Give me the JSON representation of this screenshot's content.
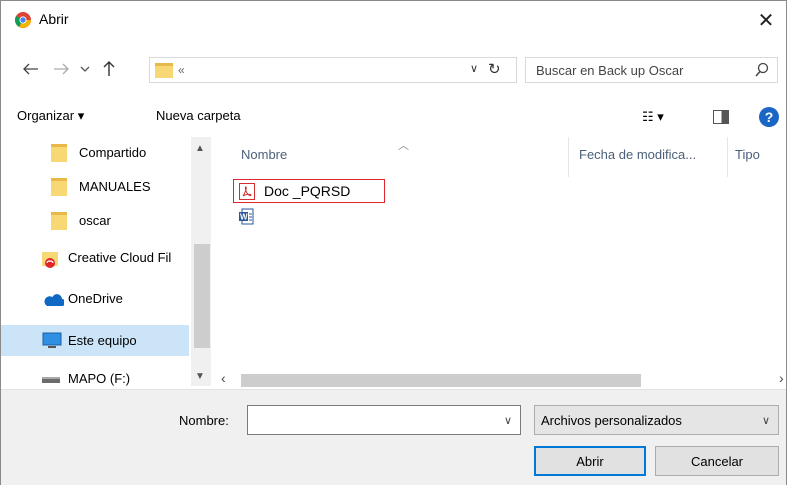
{
  "window": {
    "title": "Abrir",
    "close_glyph": "✕"
  },
  "address": {
    "crumb": "«",
    "refresh_glyph": "↻",
    "dropdown_glyph": "∨"
  },
  "search": {
    "placeholder": "Buscar en Back up Oscar"
  },
  "toolbar": {
    "organize_label": "Organizar ▾",
    "new_folder_label": "Nueva carpeta",
    "view_label": "☷ ▾",
    "help_label": "?"
  },
  "sidebar": {
    "items": [
      {
        "label": "Compartido",
        "icon": "folder-icon"
      },
      {
        "label": "MANUALES",
        "icon": "folder-icon"
      },
      {
        "label": "oscar",
        "icon": "folder-icon"
      },
      {
        "label": "Creative Cloud Fil",
        "icon": "creative-cloud-icon"
      },
      {
        "label": "OneDrive",
        "icon": "onedrive-icon"
      },
      {
        "label": "Este equipo",
        "icon": "computer-icon",
        "selected": true
      },
      {
        "label": "MAPO (F:)",
        "icon": "drive-icon"
      }
    ]
  },
  "filelist": {
    "columns": [
      "Nombre",
      "Fecha de modifica...",
      "Tipo"
    ],
    "files": [
      {
        "name": "Doc _PQRSD",
        "icon": "pdf-icon",
        "highlighted": true
      },
      {
        "name": "",
        "icon": "word-doc-icon"
      }
    ]
  },
  "bottom": {
    "name_label": "Nombre:",
    "name_value": "",
    "filter_value": "Archivos personalizados",
    "open_label": "Abrir",
    "cancel_label": "Cancelar"
  }
}
